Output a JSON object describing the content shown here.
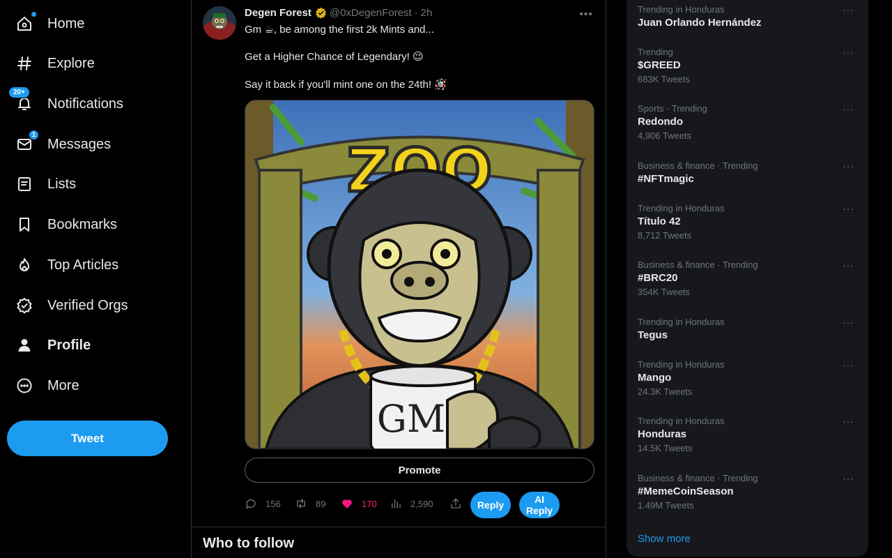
{
  "nav": {
    "items": [
      {
        "label": "Home",
        "icon": "home-icon"
      },
      {
        "label": "Explore",
        "icon": "hashtag-icon"
      },
      {
        "label": "Notifications",
        "icon": "bell-icon",
        "badge": "20+"
      },
      {
        "label": "Messages",
        "icon": "envelope-icon",
        "badge": "1"
      },
      {
        "label": "Lists",
        "icon": "list-icon"
      },
      {
        "label": "Bookmarks",
        "icon": "bookmark-icon"
      },
      {
        "label": "Top Articles",
        "icon": "flame-icon"
      },
      {
        "label": "Verified Orgs",
        "icon": "verified-badge-icon"
      },
      {
        "label": "Profile",
        "icon": "person-icon"
      },
      {
        "label": "More",
        "icon": "more-circle-icon"
      }
    ],
    "tweet_button": "Tweet"
  },
  "tweet": {
    "author_name": "Degen Forest",
    "handle": "@0xDegenForest",
    "separator": "·",
    "time": "2h",
    "line1": "Gm ☕,  be among the first 2k Mints and...",
    "line2": "Get a Higher Chance of Legendary! 😉",
    "line3": "Say it back if you'll mint one on the 24th! 🪅",
    "image_text_zoo": "ZOO",
    "image_text_mug": "GM",
    "promote_label": "Promote",
    "reply_count": "156",
    "retweet_count": "89",
    "like_count": "170",
    "view_count": "2,590",
    "reply_button": "Reply",
    "ai_reply_button": "AI Reply"
  },
  "who_to_follow": "Who to follow",
  "trends": {
    "items": [
      {
        "context": "Trending in Honduras",
        "title": "Juan Orlando Hernández",
        "count": ""
      },
      {
        "context": "Trending",
        "title": "$GREED",
        "count": "683K Tweets"
      },
      {
        "context": "Sports · Trending",
        "title": "Redondo",
        "count": "4,906 Tweets"
      },
      {
        "context": "Business & finance · Trending",
        "title": "#NFTmagic",
        "count": ""
      },
      {
        "context": "Trending in Honduras",
        "title": "Título 42",
        "count": "8,712 Tweets"
      },
      {
        "context": "Business & finance · Trending",
        "title": "#BRC20",
        "count": "354K Tweets"
      },
      {
        "context": "Trending in Honduras",
        "title": "Tegus",
        "count": ""
      },
      {
        "context": "Trending in Honduras",
        "title": "Mango",
        "count": "24.3K Tweets"
      },
      {
        "context": "Trending in Honduras",
        "title": "Honduras",
        "count": "14.5K Tweets"
      },
      {
        "context": "Business & finance · Trending",
        "title": "#MemeCoinSeason",
        "count": "1.49M Tweets"
      }
    ],
    "more_symbol": "···",
    "show_more": "Show more"
  },
  "colors": {
    "accent": "#1d9bf0",
    "like": "#f91880",
    "muted": "#71767b",
    "panel": "#16181c"
  }
}
